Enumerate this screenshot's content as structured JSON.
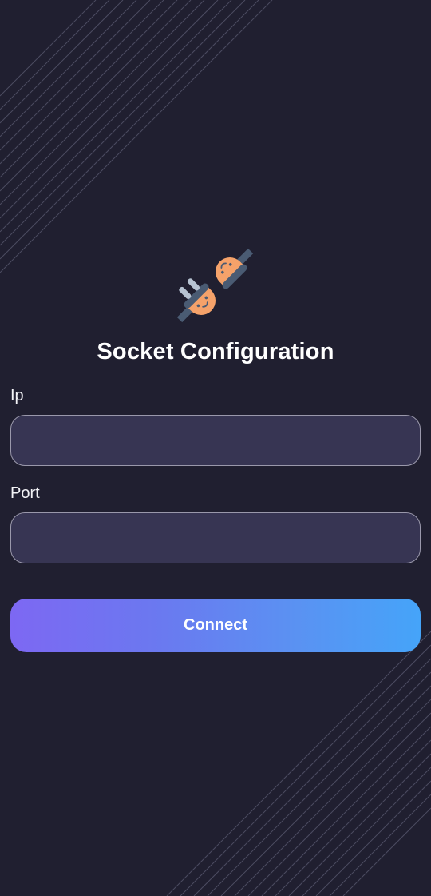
{
  "screen": {
    "title": "Socket Configuration",
    "icon": "plug-icon"
  },
  "form": {
    "ip": {
      "label": "Ip",
      "value": "",
      "placeholder": ""
    },
    "port": {
      "label": "Port",
      "value": "",
      "placeholder": ""
    }
  },
  "actions": {
    "connect_label": "Connect"
  },
  "colors": {
    "background": "#201f30",
    "input_fill": "#373553",
    "input_border": "#9a98ab",
    "button_gradient_start": "#7d68f3",
    "button_gradient_end": "#45a4f9",
    "plug_orange": "#f5a26a",
    "plug_dark": "#4a5b73",
    "plug_light": "#b7c3d2"
  }
}
